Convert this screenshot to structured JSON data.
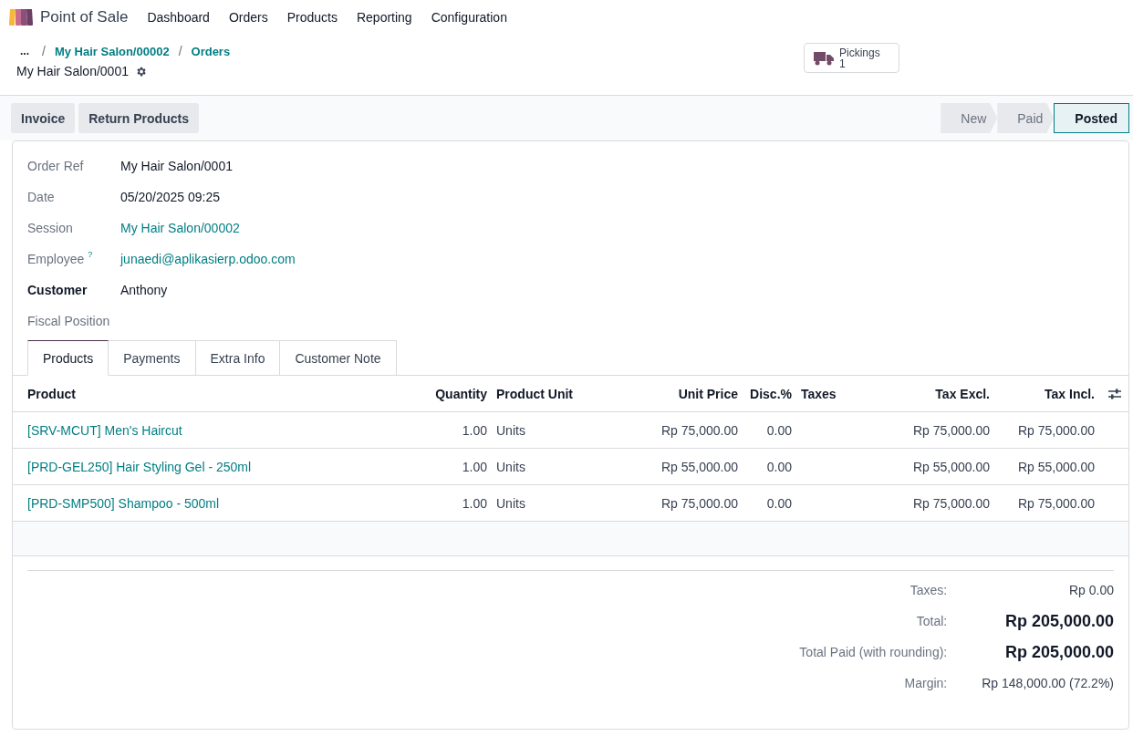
{
  "app": {
    "name": "Point of Sale"
  },
  "menu": [
    "Dashboard",
    "Orders",
    "Products",
    "Reporting",
    "Configuration"
  ],
  "breadcrumb": {
    "more": "...",
    "separator": "/",
    "items": [
      "My Hair Salon/00002",
      "Orders"
    ],
    "title": "My Hair Salon/0001"
  },
  "smart_button": {
    "label": "Pickings",
    "count": "1"
  },
  "actions": [
    "Invoice",
    "Return Products"
  ],
  "stages": [
    {
      "label": "New",
      "selected": false
    },
    {
      "label": "Paid",
      "selected": false
    },
    {
      "label": "Posted",
      "selected": true
    }
  ],
  "fields": [
    {
      "label": "Order Ref",
      "value": "My Hair Salon/0001",
      "kind": "text",
      "bold_label": false
    },
    {
      "label": "Date",
      "value": "05/20/2025 09:25",
      "kind": "text",
      "bold_label": false
    },
    {
      "label": "Session",
      "value": "My Hair Salon/00002",
      "kind": "link",
      "bold_label": false
    },
    {
      "label": "Employee",
      "help": "?",
      "value": "junaedi@aplikasierp.odoo.com",
      "kind": "link",
      "bold_label": false
    },
    {
      "label": "Customer",
      "value": "Anthony",
      "kind": "text",
      "bold_label": true
    },
    {
      "label": "Fiscal Position",
      "kind": "empty",
      "bold_label": false
    }
  ],
  "tabs": [
    {
      "label": "Products",
      "selected": true
    },
    {
      "label": "Payments",
      "selected": false
    },
    {
      "label": "Extra Info",
      "selected": false
    },
    {
      "label": "Customer Note",
      "selected": false
    }
  ],
  "table": {
    "columns": [
      {
        "label": "Product",
        "kind": "text"
      },
      {
        "label": "Quantity",
        "kind": "number"
      },
      {
        "label": "Product Unit",
        "kind": "text"
      },
      {
        "label": "Unit Price",
        "kind": "number"
      },
      {
        "label": "Disc.%",
        "kind": "number"
      },
      {
        "label": "Taxes",
        "kind": "text"
      },
      {
        "label": "Tax Excl.",
        "kind": "number"
      },
      {
        "label": "Tax Incl.",
        "kind": "number"
      }
    ],
    "rows": [
      [
        "[SRV-MCUT] Men's Haircut",
        "1.00",
        "Units",
        "Rp 75,000.00",
        "0.00",
        "",
        "Rp 75,000.00",
        "Rp 75,000.00"
      ],
      [
        "[PRD-GEL250] Hair Styling Gel - 250ml",
        "1.00",
        "Units",
        "Rp 55,000.00",
        "0.00",
        "",
        "Rp 55,000.00",
        "Rp 55,000.00"
      ],
      [
        "[PRD-SMP500] Shampoo - 500ml",
        "1.00",
        "Units",
        "Rp 75,000.00",
        "0.00",
        "",
        "Rp 75,000.00",
        "Rp 75,000.00"
      ]
    ]
  },
  "summary": [
    {
      "label": "Taxes:",
      "value": "Rp 0.00",
      "kind": "normal"
    },
    {
      "label": "Total:",
      "value": "Rp 205,000.00",
      "kind": "large"
    },
    {
      "label": "Total Paid (with rounding):",
      "value": "Rp 205,000.00",
      "kind": "large"
    },
    {
      "label": "Margin:",
      "value": "Rp 148,000.00 (72.2%)",
      "kind": "normal"
    }
  ]
}
